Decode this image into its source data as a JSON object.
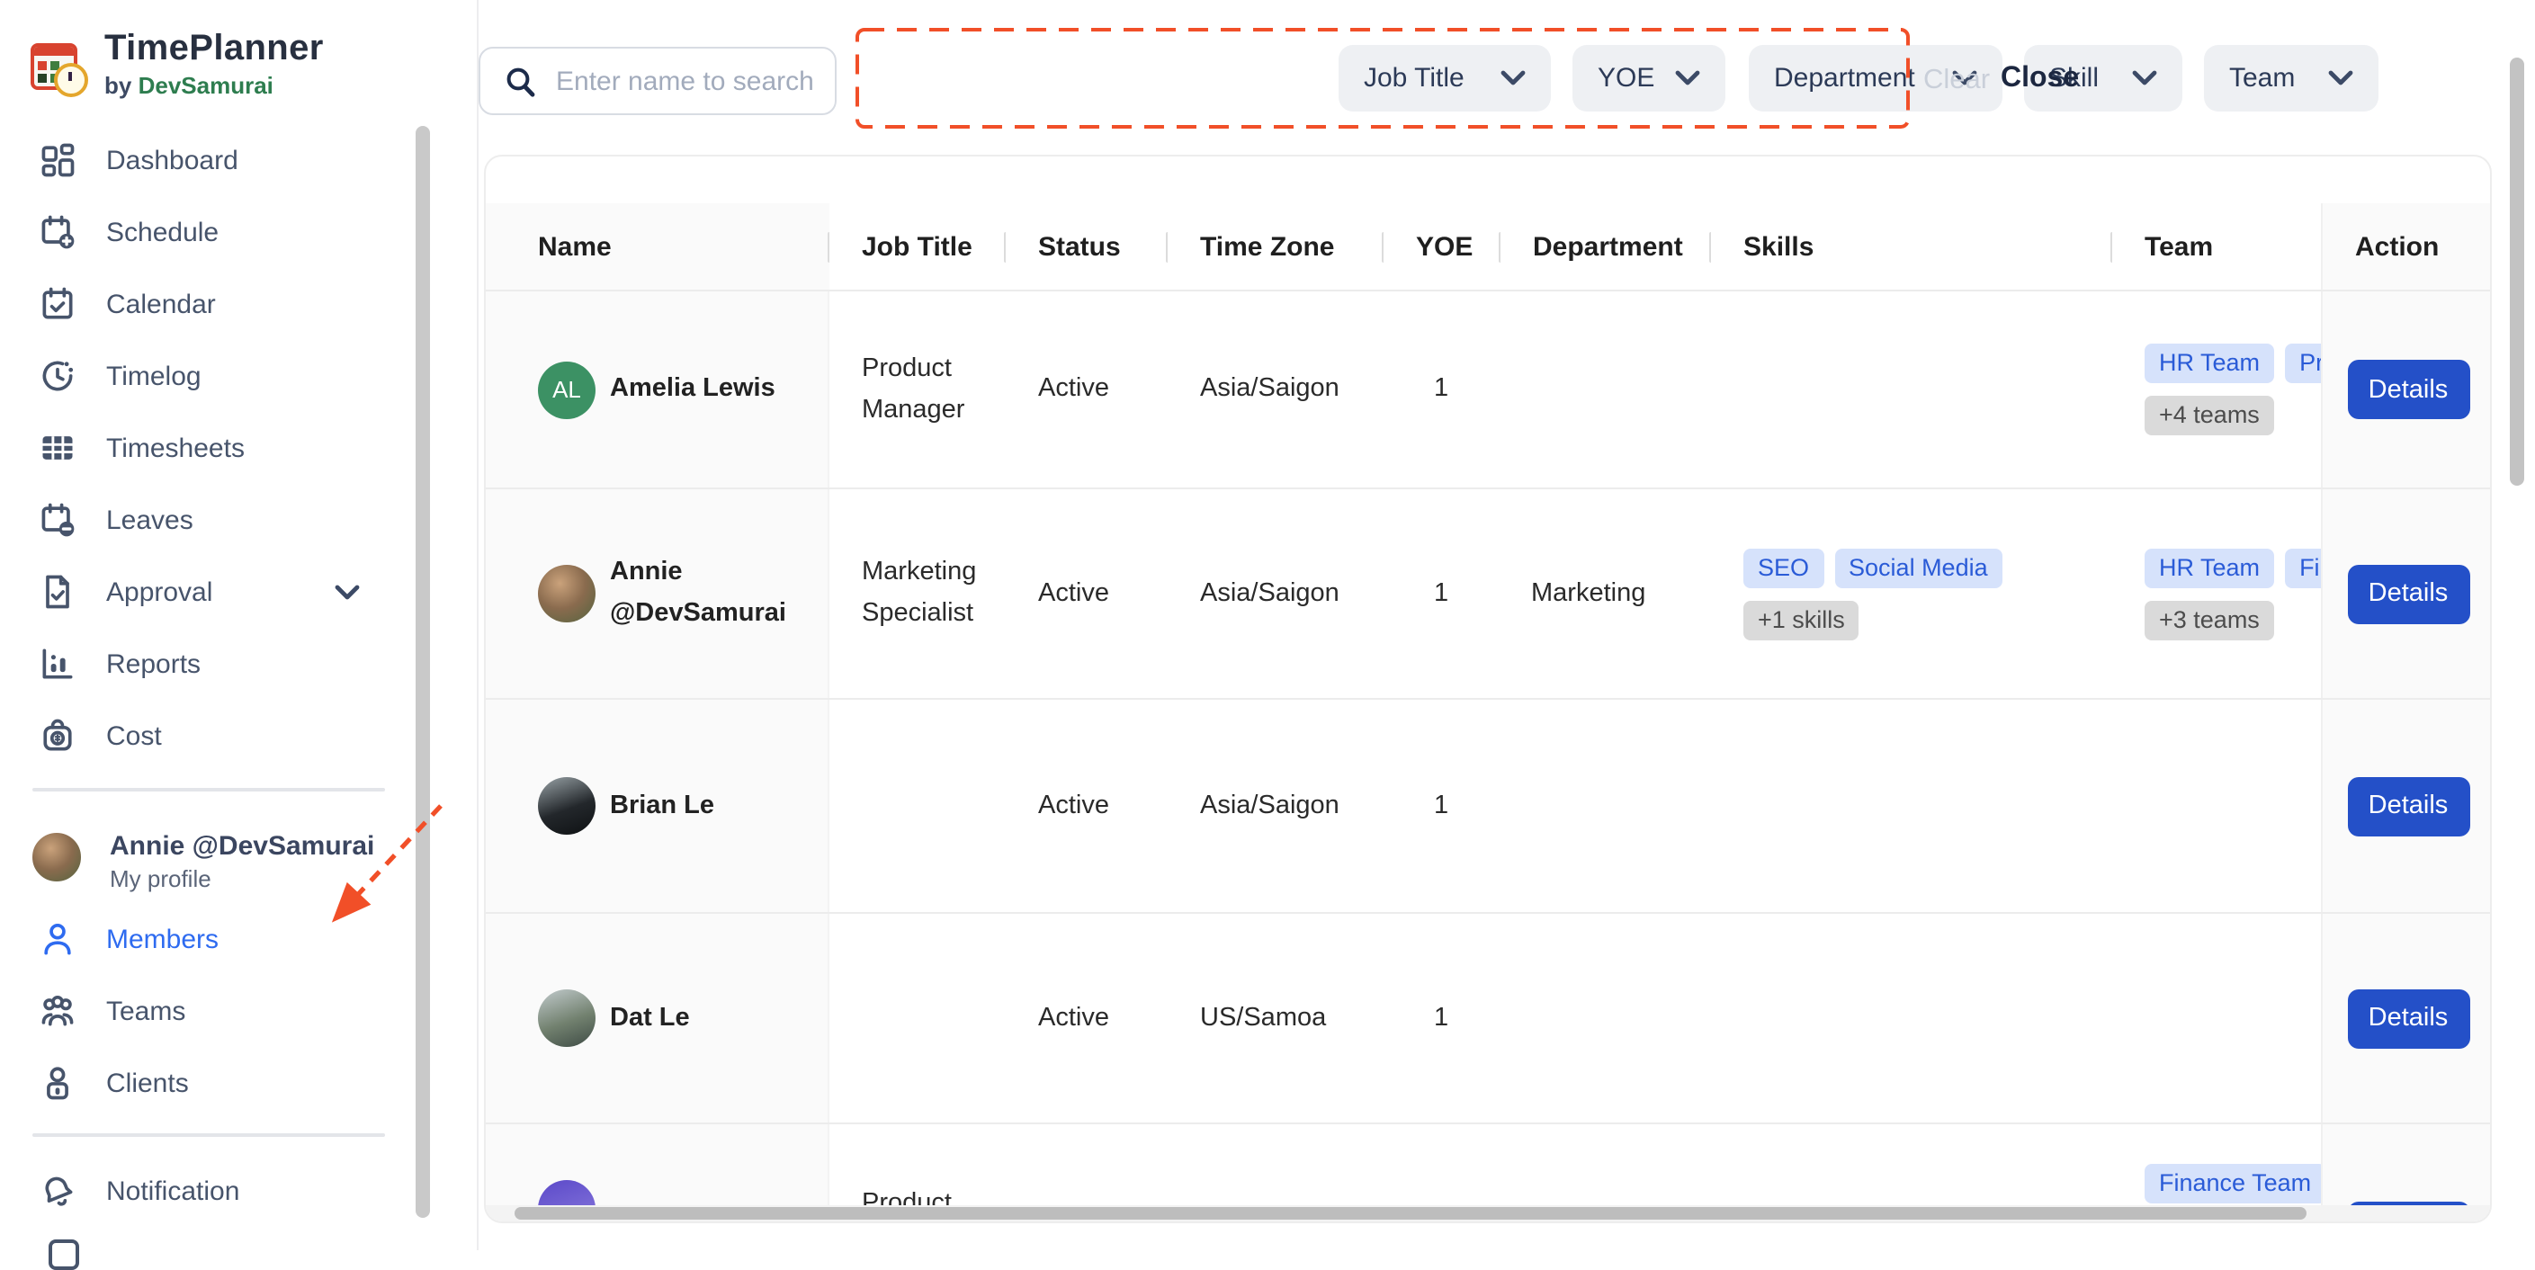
{
  "app": {
    "title": "TimePlanner",
    "byline_prefix": "by",
    "byline_brand": "DevSamurai"
  },
  "colors": {
    "accent_blue": "#2e6bf0",
    "button_blue": "#2450c8",
    "pill_blue_bg": "#d6e2fb",
    "pill_blue_text": "#2a5bd7",
    "pill_gray_bg": "#dadada",
    "annotation_red": "#f14f28",
    "sidebar_text": "#47546b",
    "brand_green": "#2e7d4f",
    "avatar_green": "#3c9164",
    "avatar_purple": "#5b49c9"
  },
  "sidebar": {
    "nav_top": [
      {
        "id": "dashboard",
        "label": "Dashboard",
        "icon": "dashboard-icon"
      },
      {
        "id": "schedule",
        "label": "Schedule",
        "icon": "calendar-plus-icon"
      },
      {
        "id": "calendar",
        "label": "Calendar",
        "icon": "calendar-check-icon"
      },
      {
        "id": "timelog",
        "label": "Timelog",
        "icon": "clock-icon"
      },
      {
        "id": "timesheets",
        "label": "Timesheets",
        "icon": "table-grid-icon"
      },
      {
        "id": "leaves",
        "label": "Leaves",
        "icon": "calendar-minus-icon"
      },
      {
        "id": "approval",
        "label": "Approval",
        "icon": "file-check-icon",
        "chevron": true
      },
      {
        "id": "reports",
        "label": "Reports",
        "icon": "bar-chart-icon"
      },
      {
        "id": "cost",
        "label": "Cost",
        "icon": "money-bag-icon"
      }
    ],
    "profile": {
      "name": "Annie @DevSamurai",
      "subtitle": "My profile"
    },
    "nav_mid": [
      {
        "id": "members",
        "label": "Members",
        "icon": "person-icon",
        "active": true
      },
      {
        "id": "teams",
        "label": "Teams",
        "icon": "people-icon"
      },
      {
        "id": "clients",
        "label": "Clients",
        "icon": "person-badge-icon"
      }
    ],
    "nav_bottom": [
      {
        "id": "notification",
        "label": "Notification",
        "icon": "bell-icon"
      }
    ]
  },
  "topbar": {
    "search_placeholder": "Enter name to search",
    "filters": [
      {
        "id": "job-title",
        "label": "Job Title"
      },
      {
        "id": "yoe",
        "label": "YOE"
      },
      {
        "id": "department",
        "label": "Department"
      },
      {
        "id": "skill",
        "label": "Skill"
      },
      {
        "id": "team",
        "label": "Team"
      }
    ],
    "clear_label": "Clear",
    "close_label": "Close"
  },
  "table": {
    "columns": [
      "Name",
      "Job Title",
      "Status",
      "Time Zone",
      "YOE",
      "Department",
      "Skills",
      "Team",
      "Action"
    ],
    "action_label": "Details",
    "rows": [
      {
        "name_lines": [
          "Amelia Lewis"
        ],
        "avatar": {
          "kind": "initials",
          "label": "AL",
          "bg": "#3c9164"
        },
        "job_lines": [
          "Product",
          "Manager"
        ],
        "status": "Active",
        "time_zone": "Asia/Saigon",
        "yoe": "1",
        "department": "",
        "skills": {
          "pills": [],
          "more": ""
        },
        "teams": {
          "pills": [
            "HR Team",
            "Pr"
          ],
          "more": "+4 teams"
        }
      },
      {
        "name_lines": [
          "Annie",
          "@DevSamurai"
        ],
        "avatar": {
          "kind": "photo",
          "bg": "radial-gradient(circle at 38% 32%, #caa27b 0%, #8a6b4e 48%, #53643f 100%)"
        },
        "job_lines": [
          "Marketing",
          "Specialist"
        ],
        "status": "Active",
        "time_zone": "Asia/Saigon",
        "yoe": "1",
        "department": "Marketing",
        "skills": {
          "pills": [
            "SEO",
            "Social Media"
          ],
          "more": "+1 skills"
        },
        "teams": {
          "pills": [
            "HR Team",
            "Fi"
          ],
          "more": "+3 teams"
        }
      },
      {
        "name_lines": [
          "Brian Le"
        ],
        "avatar": {
          "kind": "photo",
          "bg": "linear-gradient(160deg, #9aa4a8 0%, #23272b 55%, #0e1113 100%)"
        },
        "job_lines": [],
        "status": "Active",
        "time_zone": "Asia/Saigon",
        "yoe": "1",
        "department": "",
        "skills": {
          "pills": [],
          "more": ""
        },
        "teams": {
          "pills": [],
          "more": ""
        }
      },
      {
        "name_lines": [
          "Dat Le"
        ],
        "avatar": {
          "kind": "photo",
          "bg": "linear-gradient(160deg, #c2cbcd 0%, #72816f 55%, #3e4b45 100%)"
        },
        "job_lines": [],
        "status": "Active",
        "time_zone": "US/Samoa",
        "yoe": "1",
        "department": "",
        "skills": {
          "pills": [],
          "more": ""
        },
        "teams": {
          "pills": [],
          "more": ""
        }
      },
      {
        "partial": true,
        "name_lines": [],
        "avatar": {
          "kind": "photo",
          "bg": "linear-gradient(160deg, #5b49c9 0%, #7a6ad6 60%, #cfc9ee 100%)"
        },
        "job_lines": [
          "Product"
        ],
        "status": "",
        "time_zone": "",
        "yoe": "",
        "department": "",
        "skills": {
          "pills": [],
          "more": ""
        },
        "teams": {
          "pills": [
            "Finance Team"
          ],
          "more": ""
        }
      }
    ]
  }
}
